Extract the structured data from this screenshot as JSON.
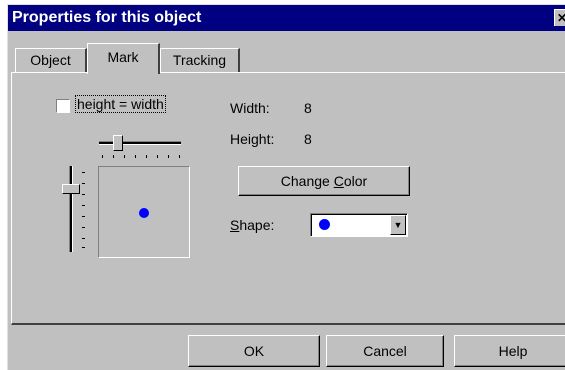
{
  "window": {
    "title": "Properties for this object",
    "close_glyph": "✕"
  },
  "tabs": [
    {
      "label": "Object",
      "active": false
    },
    {
      "label": "Mark",
      "active": true
    },
    {
      "label": "Tracking",
      "active": false
    }
  ],
  "mark": {
    "height_equals_width": {
      "label": "height = width",
      "checked": false
    },
    "width": {
      "label": "Width:",
      "value": "8"
    },
    "height": {
      "label": "Height:",
      "value": "8"
    },
    "change_color": {
      "pre": "Change ",
      "accel": "C",
      "post": "olor"
    },
    "shape": {
      "accel": "S",
      "label_rest": "hape:",
      "selected": "circle",
      "color": "#0000ff"
    },
    "preview": {
      "dot_color": "#0000ff",
      "icon": "circle-mark"
    }
  },
  "footer": {
    "ok": "OK",
    "cancel": "Cancel",
    "help": "Help"
  }
}
